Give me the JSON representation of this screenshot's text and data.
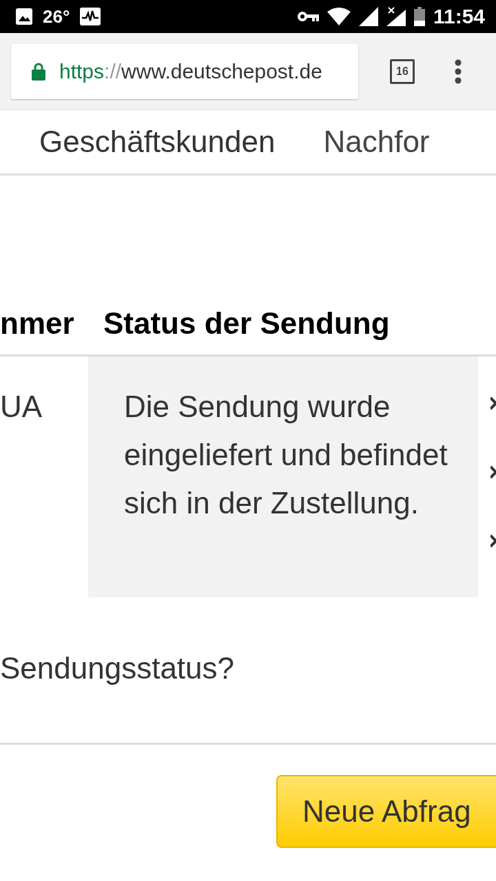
{
  "status_bar": {
    "temperature": "26°",
    "time": "11:54"
  },
  "browser": {
    "url_scheme": "https",
    "url_separator": "://",
    "url_host": "www.deutschepost.de",
    "tab_count": "16"
  },
  "nav": {
    "items": [
      {
        "label": "Geschäftskunden"
      },
      {
        "label": "Nachfor"
      }
    ]
  },
  "table": {
    "columns": [
      {
        "label": "nmer"
      },
      {
        "label": "Status der Sendung"
      }
    ],
    "rows": [
      {
        "cells": [
          "UA",
          "Die Sendung wurde eingeliefert und befindet sich in der Zustellung."
        ]
      }
    ]
  },
  "question": "Sendungsstatus?",
  "button": {
    "label": "Neue Abfrag"
  }
}
